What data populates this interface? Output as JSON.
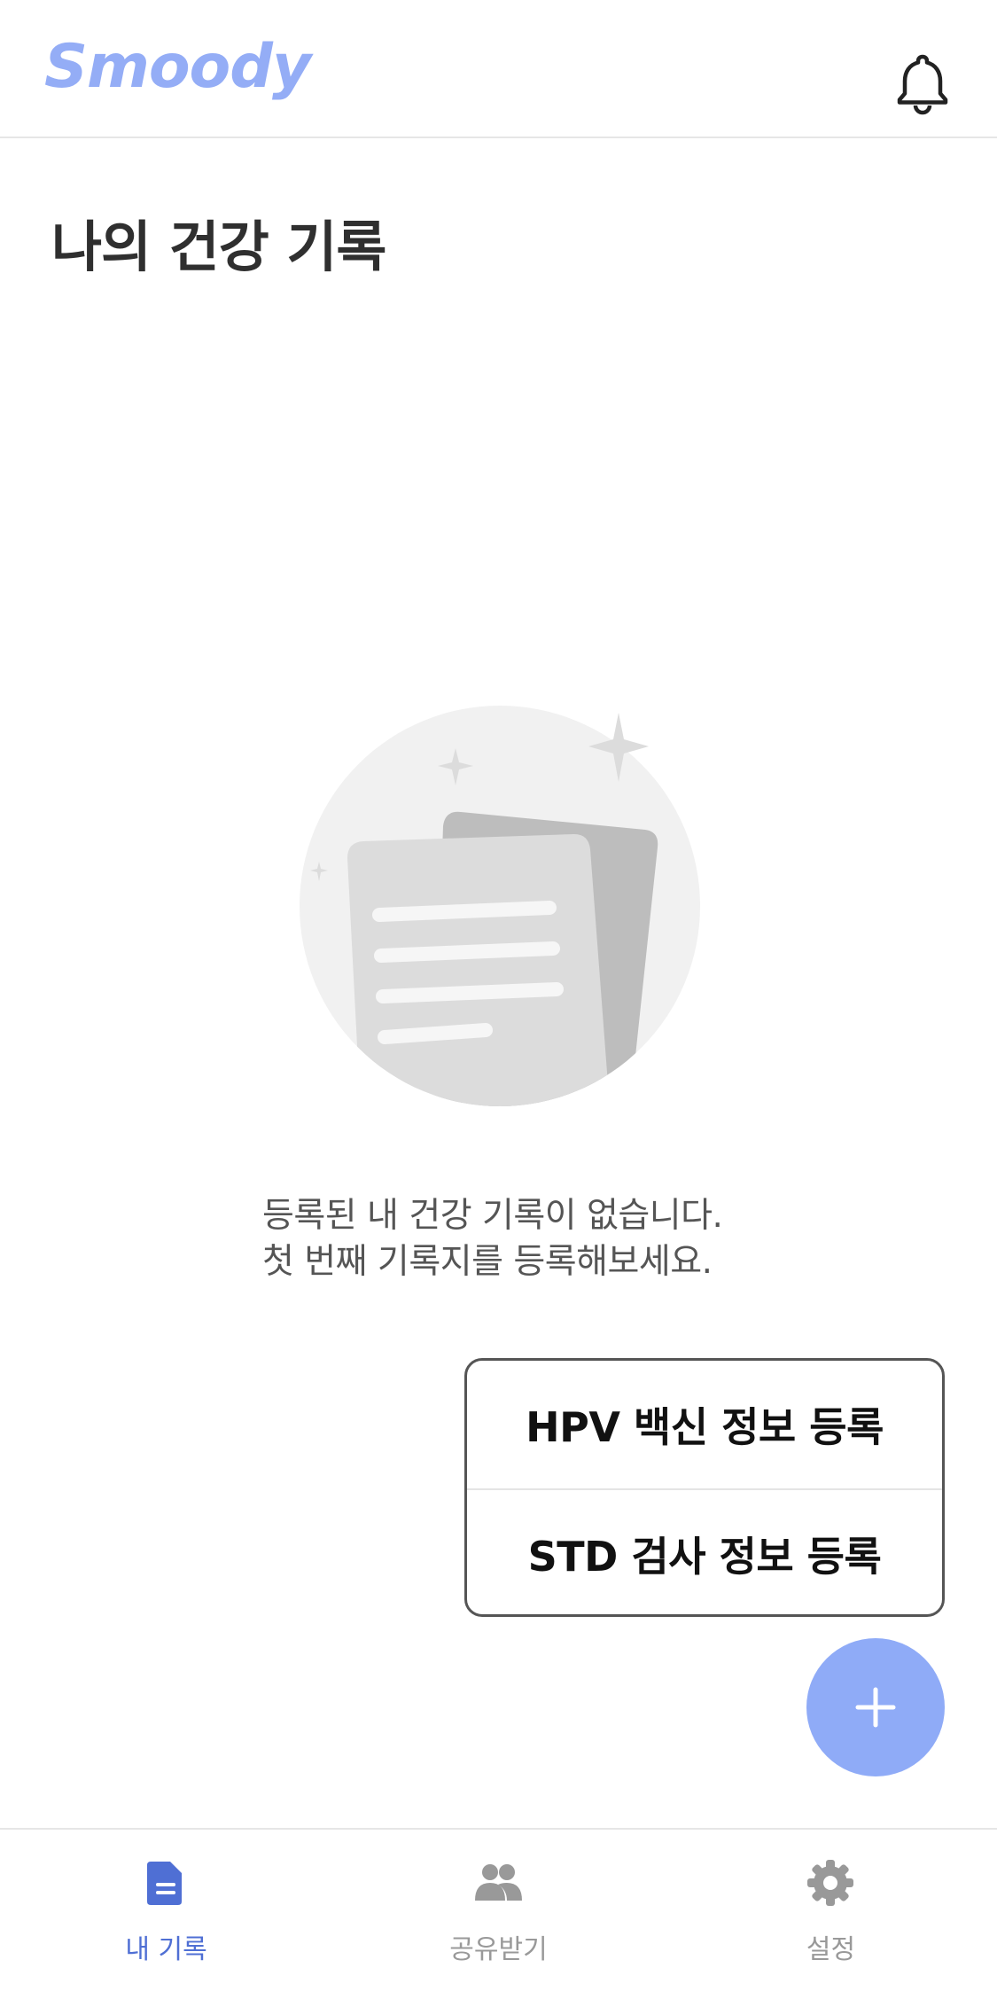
{
  "header": {
    "logo_text": "Smoody",
    "bell_icon": "bell-icon"
  },
  "page": {
    "title": "나의 건강 기록"
  },
  "empty_state": {
    "illustration_icon": "documents-illustration",
    "line1": "등록된 내 건강 기록이 없습니다.",
    "line2": "첫 번째 기록지를 등록해보세요."
  },
  "add_menu": {
    "items": [
      {
        "label": "HPV 백신 정보 등록"
      },
      {
        "label": "STD 검사 정보 등록"
      }
    ]
  },
  "fab": {
    "icon": "plus-icon"
  },
  "tabbar": {
    "tabs": [
      {
        "label": "내 기록",
        "icon": "document-icon",
        "active": true
      },
      {
        "label": "공유받기",
        "icon": "people-icon",
        "active": false
      },
      {
        "label": "설정",
        "icon": "gear-icon",
        "active": false
      }
    ]
  },
  "colors": {
    "brand": "#8fabf7",
    "active_tab": "#4f6fd4",
    "inactive_tab": "#999999",
    "title_text": "#2f2f2f"
  }
}
